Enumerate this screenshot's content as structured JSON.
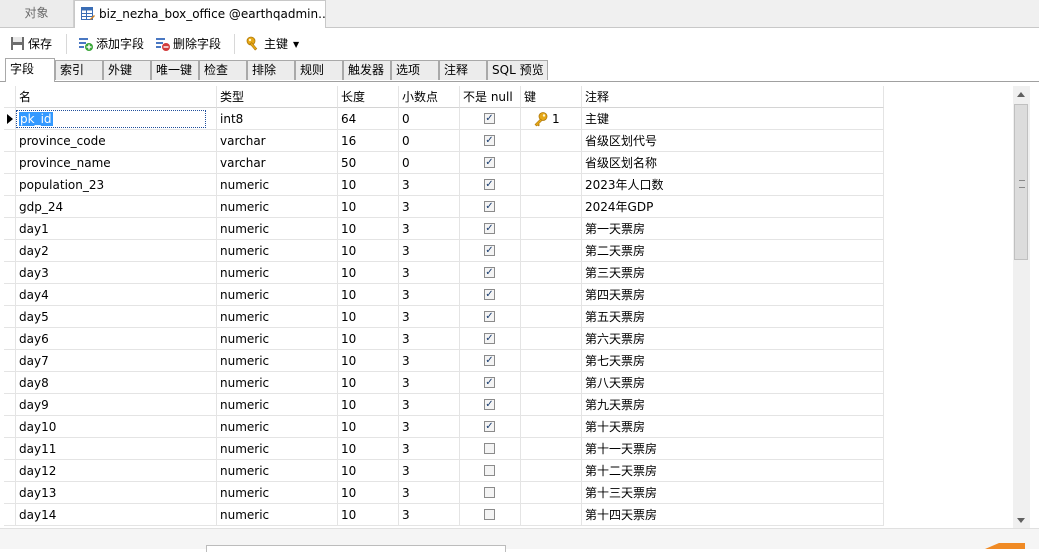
{
  "doc_tabs": {
    "objects_label": "对象",
    "active_label": "biz_nezha_box_office @earthqadmin..."
  },
  "toolbar": {
    "save_label": "保存",
    "add_field_label": "添加字段",
    "delete_field_label": "删除字段",
    "primary_key_label": "主键"
  },
  "prop_tabs": [
    {
      "label": "字段"
    },
    {
      "label": "索引"
    },
    {
      "label": "外键"
    },
    {
      "label": "唯一键"
    },
    {
      "label": "检查"
    },
    {
      "label": "排除"
    },
    {
      "label": "规则"
    },
    {
      "label": "触发器"
    },
    {
      "label": "选项"
    },
    {
      "label": "注释"
    },
    {
      "label": "SQL 预览"
    }
  ],
  "grid": {
    "headers": {
      "name": "名",
      "type": "类型",
      "length": "长度",
      "decimals": "小数点",
      "not_null": "不是 null",
      "key": "键",
      "comment": "注释"
    },
    "rows": [
      {
        "name": "pk_id",
        "type": "int8",
        "length": "64",
        "decimals": "0",
        "not_null": true,
        "key": "1",
        "comment": "主键"
      },
      {
        "name": "province_code",
        "type": "varchar",
        "length": "16",
        "decimals": "0",
        "not_null": true,
        "key": "",
        "comment": "省级区划代号"
      },
      {
        "name": "province_name",
        "type": "varchar",
        "length": "50",
        "decimals": "0",
        "not_null": true,
        "key": "",
        "comment": "省级区划名称"
      },
      {
        "name": "population_23",
        "type": "numeric",
        "length": "10",
        "decimals": "3",
        "not_null": true,
        "key": "",
        "comment": "2023年人口数"
      },
      {
        "name": "gdp_24",
        "type": "numeric",
        "length": "10",
        "decimals": "3",
        "not_null": true,
        "key": "",
        "comment": "2024年GDP"
      },
      {
        "name": "day1",
        "type": "numeric",
        "length": "10",
        "decimals": "3",
        "not_null": true,
        "key": "",
        "comment": "第一天票房"
      },
      {
        "name": "day2",
        "type": "numeric",
        "length": "10",
        "decimals": "3",
        "not_null": true,
        "key": "",
        "comment": "第二天票房"
      },
      {
        "name": "day3",
        "type": "numeric",
        "length": "10",
        "decimals": "3",
        "not_null": true,
        "key": "",
        "comment": "第三天票房"
      },
      {
        "name": "day4",
        "type": "numeric",
        "length": "10",
        "decimals": "3",
        "not_null": true,
        "key": "",
        "comment": "第四天票房"
      },
      {
        "name": "day5",
        "type": "numeric",
        "length": "10",
        "decimals": "3",
        "not_null": true,
        "key": "",
        "comment": "第五天票房"
      },
      {
        "name": "day6",
        "type": "numeric",
        "length": "10",
        "decimals": "3",
        "not_null": true,
        "key": "",
        "comment": "第六天票房"
      },
      {
        "name": "day7",
        "type": "numeric",
        "length": "10",
        "decimals": "3",
        "not_null": true,
        "key": "",
        "comment": "第七天票房"
      },
      {
        "name": "day8",
        "type": "numeric",
        "length": "10",
        "decimals": "3",
        "not_null": true,
        "key": "",
        "comment": "第八天票房"
      },
      {
        "name": "day9",
        "type": "numeric",
        "length": "10",
        "decimals": "3",
        "not_null": true,
        "key": "",
        "comment": "第九天票房"
      },
      {
        "name": "day10",
        "type": "numeric",
        "length": "10",
        "decimals": "3",
        "not_null": true,
        "key": "",
        "comment": "第十天票房"
      },
      {
        "name": "day11",
        "type": "numeric",
        "length": "10",
        "decimals": "3",
        "not_null": false,
        "key": "",
        "comment": "第十一天票房"
      },
      {
        "name": "day12",
        "type": "numeric",
        "length": "10",
        "decimals": "3",
        "not_null": false,
        "key": "",
        "comment": "第十二天票房"
      },
      {
        "name": "day13",
        "type": "numeric",
        "length": "10",
        "decimals": "3",
        "not_null": false,
        "key": "",
        "comment": "第十三天票房"
      },
      {
        "name": "day14",
        "type": "numeric",
        "length": "10",
        "decimals": "3",
        "not_null": false,
        "key": "",
        "comment": "第十四天票房"
      }
    ]
  },
  "icons": {
    "save": "save-icon",
    "add_field": "add-field-icon",
    "delete_field": "delete-field-icon",
    "primary_key": "key-icon",
    "table": "table-design-icon"
  },
  "colors": {
    "selection": "#3399ff",
    "key_gold": "#e6a817"
  }
}
